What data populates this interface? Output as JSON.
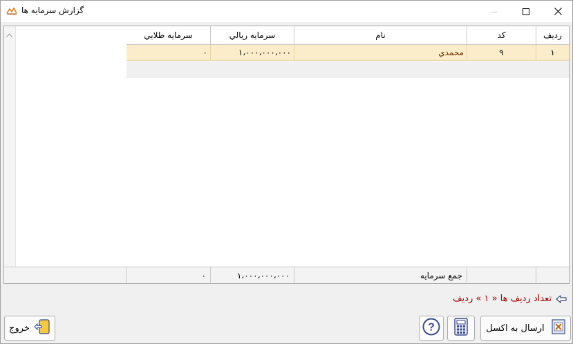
{
  "window": {
    "title": "گزارش سرمايه ها",
    "icon": "app-logo-icon"
  },
  "controls": {
    "minimize": "minimize-icon",
    "maximize": "maximize-icon",
    "close": "close-icon"
  },
  "table": {
    "columns": {
      "row": "رديف",
      "code": "کد",
      "name": "نام",
      "rial": "سرمايه ريالي",
      "gold": "سرمايه طلايي"
    },
    "rows": [
      {
        "row": "١",
        "code": "٩",
        "name": "محمدي",
        "rial": "١،٠٠٠،٠٠٠،٠٠٠",
        "gold": "٠"
      }
    ],
    "footer": {
      "label": "جمع سرمايه",
      "rial_total": "١،٠٠٠،٠٠٠،٠٠٠",
      "gold_total": "٠"
    }
  },
  "status": {
    "text": "تعداد رديف ها « ١ » رديف",
    "color": "#a10000"
  },
  "buttons": {
    "excel": "ارسال به اکسل",
    "exit": "خروج"
  },
  "colors": {
    "selected_row": "#fbedc9",
    "name_text": "#6b2f00"
  }
}
